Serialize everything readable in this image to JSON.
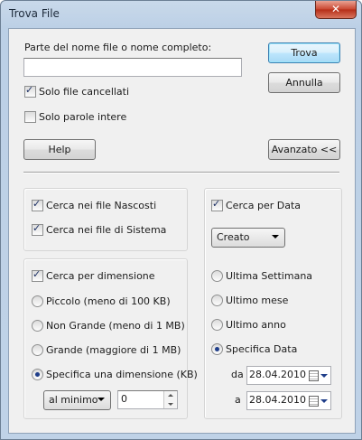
{
  "window": {
    "title": "Trova File",
    "close_glyph": "✕"
  },
  "search": {
    "name_label": "Parte del nome file o nome completo:",
    "name_value": "",
    "deleted_only_label": "Solo file cancellati",
    "deleted_only_checked": true,
    "whole_words_label": "Solo parole intere",
    "whole_words_checked": false
  },
  "buttons": {
    "find": "Trova",
    "cancel": "Annulla",
    "help": "Help",
    "advanced": "Avanzato <<"
  },
  "attributes": {
    "hidden_label": "Cerca nei file Nascosti",
    "hidden_checked": true,
    "system_label": "Cerca nei file di Sistema",
    "system_checked": true
  },
  "size": {
    "enable_label": "Cerca per dimensione",
    "enable_checked": true,
    "options": [
      {
        "label": "Piccolo (meno di 100 KB)",
        "selected": false
      },
      {
        "label": "Non Grande (meno di 1 MB)",
        "selected": false
      },
      {
        "label": "Grande (maggiore di 1 MB)",
        "selected": false
      },
      {
        "label": "Specifica una dimensione (KB)",
        "selected": true
      }
    ],
    "mode_value": "al minimo",
    "amount_value": "0"
  },
  "date": {
    "enable_label": "Cerca per Data",
    "enable_checked": true,
    "type_value": "Creato",
    "options": [
      {
        "label": "Ultima Settimana",
        "selected": false
      },
      {
        "label": "Ultimo mese",
        "selected": false
      },
      {
        "label": "Ultimo anno",
        "selected": false
      },
      {
        "label": "Specifica Data",
        "selected": true
      }
    ],
    "from_label": "da",
    "from_value": "28.04.2010",
    "to_label": "a",
    "to_value": "28.04.2010"
  },
  "icons": {
    "close": "close-icon",
    "calendar": "calendar-icon",
    "dropdown": "chevron-down-icon"
  },
  "colors": {
    "titlebar": "#bcd0e6",
    "close_button": "#c9452e",
    "default_button_border": "#3c7fb1",
    "dialog_bg": "#f0f0f0"
  }
}
